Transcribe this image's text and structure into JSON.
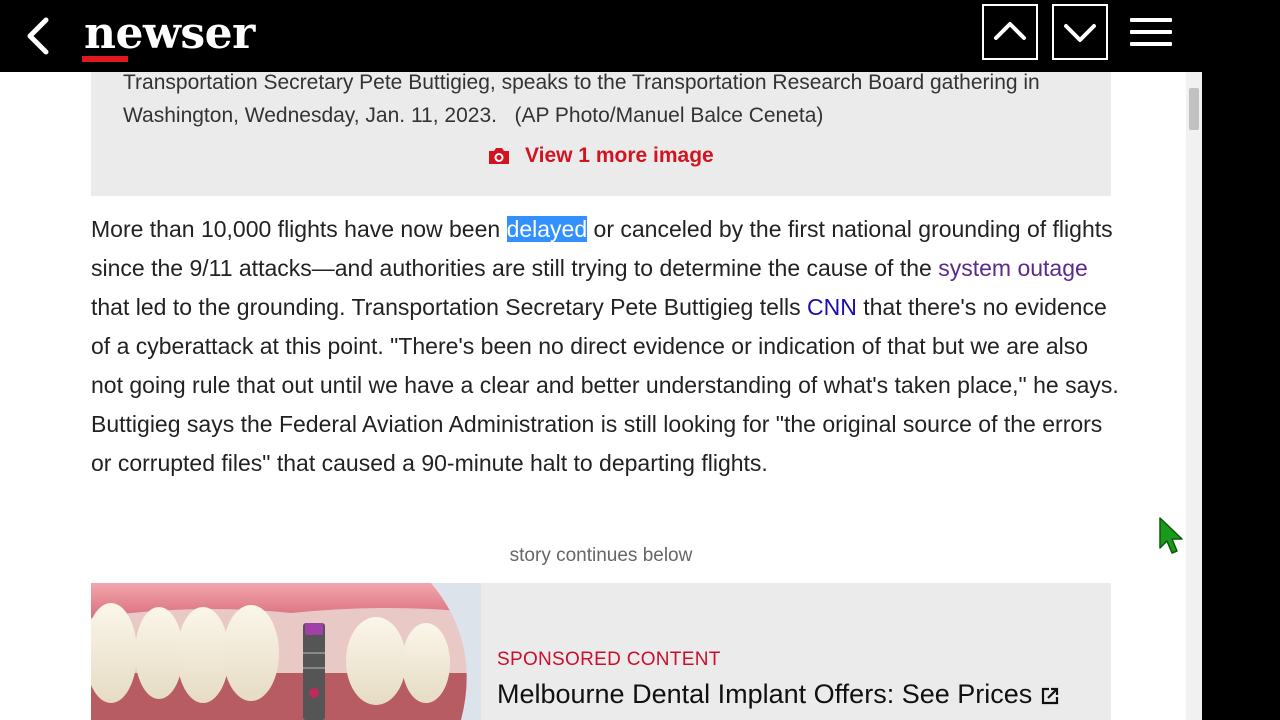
{
  "header": {
    "logo": "newser",
    "colors": {
      "background": "#000000",
      "accent": "#e0191e"
    }
  },
  "caption": {
    "line1": "Transportation Secretary Pete Buttigieg, speaks to the Transportation Research Board gathering in",
    "line2": "Washington, Wednesday, Jan. 11, 2023.   (AP Photo/Manuel Balce Ceneta)",
    "view_more": "View 1 more image"
  },
  "article": {
    "p1_before": "More than 10,000 flights have now been ",
    "p1_highlight": "delayed",
    "p1_mid": " or canceled by the first national grounding of flights since the 9/11 attacks—and authorities are still trying to determine the cause of the ",
    "p1_link1": "system outage",
    "p1_mid2": " that led to the grounding. Transportation Secretary Pete Buttigieg tells ",
    "p1_link2": "CNN",
    "p1_after": " that there's no evidence of a cyberattack at this point. \"There's been no direct evidence or indication of that but we are also not going rule that out until we have a clear and better understanding of what's taken place,\" he says. Buttigieg says the Federal Aviation Administration is still looking for \"the original source of the errors or corrupted files\" that caused a 90-minute halt to departing flights."
  },
  "story_continues": "story continues below",
  "sponsored": {
    "label": "SPONSORED CONTENT",
    "title": "Melbourne Dental Implant Offers: See Prices"
  },
  "icons": [
    "back-chevron-icon",
    "chevron-up-icon",
    "chevron-down-icon",
    "hamburger-menu-icon",
    "camera-icon",
    "external-link-icon",
    "mouse-cursor-icon"
  ]
}
